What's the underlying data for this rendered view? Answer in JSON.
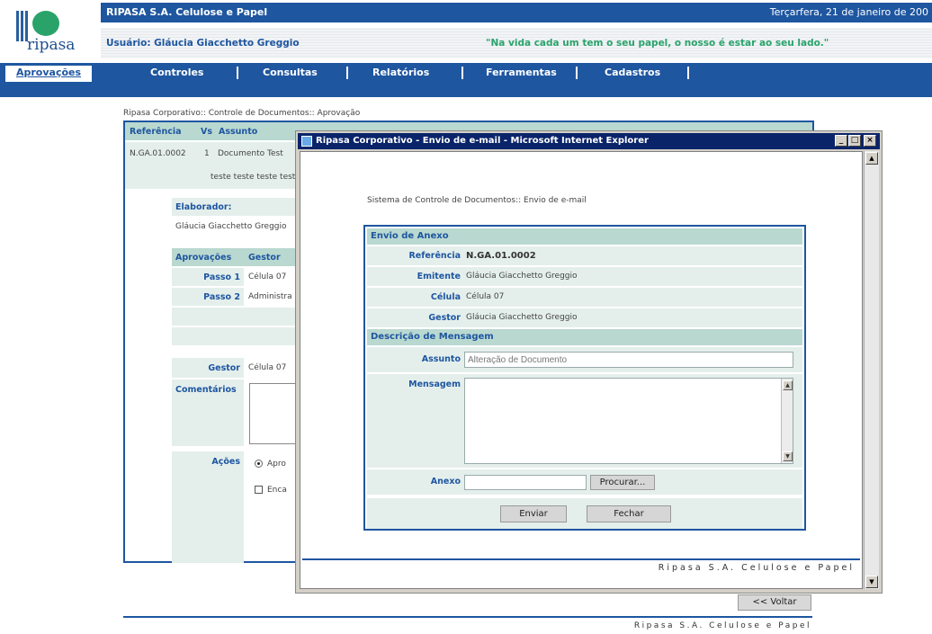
{
  "header": {
    "logo_text": "ripasa",
    "company": "RIPASA S.A. Celulose e Papel",
    "date": "Terçarfera, 21 de janeiro de 200",
    "user": "Usuário: Gláucia Giacchetto Greggio",
    "motto": "\"Na vida cada um tem o seu papel, o nosso é estar ao seu lado.\""
  },
  "nav": {
    "items": [
      "Aprovações",
      "Controles",
      "Consultas",
      "Relatórios",
      "Ferramentas",
      "Cadastros"
    ]
  },
  "background_page": {
    "breadcrumb": "Ripasa Corporativo:: Controle de Documentos:: Aprovação",
    "table_headers": [
      "Referência",
      "Vs",
      "Assunto"
    ],
    "ref": "N.GA.01.0002",
    "vs": "1",
    "assunto": "Documento Test",
    "assunto_line2": "teste teste teste test",
    "elaborador_label": "Elaborador:",
    "elaborador_value": "Gláucia Giacchetto Greggio",
    "approvals_header": "Aprovações",
    "gestor_header": "Gestor",
    "passo1_label": "Passo 1",
    "passo1_value": "Célula 07",
    "passo2_label": "Passo 2",
    "passo2_value": "Administra",
    "gestor_label": "Gestor",
    "gestor_value": "Célula 07",
    "comentarios_label": "Comentários",
    "acoes_label": "Ações",
    "radio_label": "Apro",
    "check_label": "Enca",
    "voltar": "<< Voltar",
    "footer": "Ripasa S.A. Celulose e Papel"
  },
  "popup": {
    "title": "Ripasa Corporativo - Envio de e-mail - Microsoft Internet Explorer",
    "win_buttons": [
      "_",
      "□",
      "×"
    ],
    "breadcrumb": "Sistema de Controle de Documentos:: Envio de e-mail",
    "section1": "Envio de Anexo",
    "referencia_label": "Referência",
    "referencia_value": "N.GA.01.0002",
    "emitente_label": "Emitente",
    "emitente_value": "Gláucia Giacchetto Greggio",
    "celula_label": "Célula",
    "celula_value": "Célula 07",
    "gestor_label": "Gestor",
    "gestor_value": "Gláucia Giacchetto Greggio",
    "section2": "Descrição de Mensagem",
    "assunto_label": "Assunto",
    "assunto_value": "Alteração de Documento",
    "mensagem_label": "Mensagem",
    "mensagem_value": "",
    "anexo_label": "Anexo",
    "anexo_value": "",
    "procurar": "Procurar...",
    "enviar": "Enviar",
    "fechar": "Fechar",
    "footer": "Ripasa S.A. Celulose e Papel"
  },
  "colors": {
    "brand_blue": "#1e56a0",
    "brand_green": "#2aa36b",
    "header_teal": "#b9d8d0",
    "row_teal": "#e4efec"
  }
}
